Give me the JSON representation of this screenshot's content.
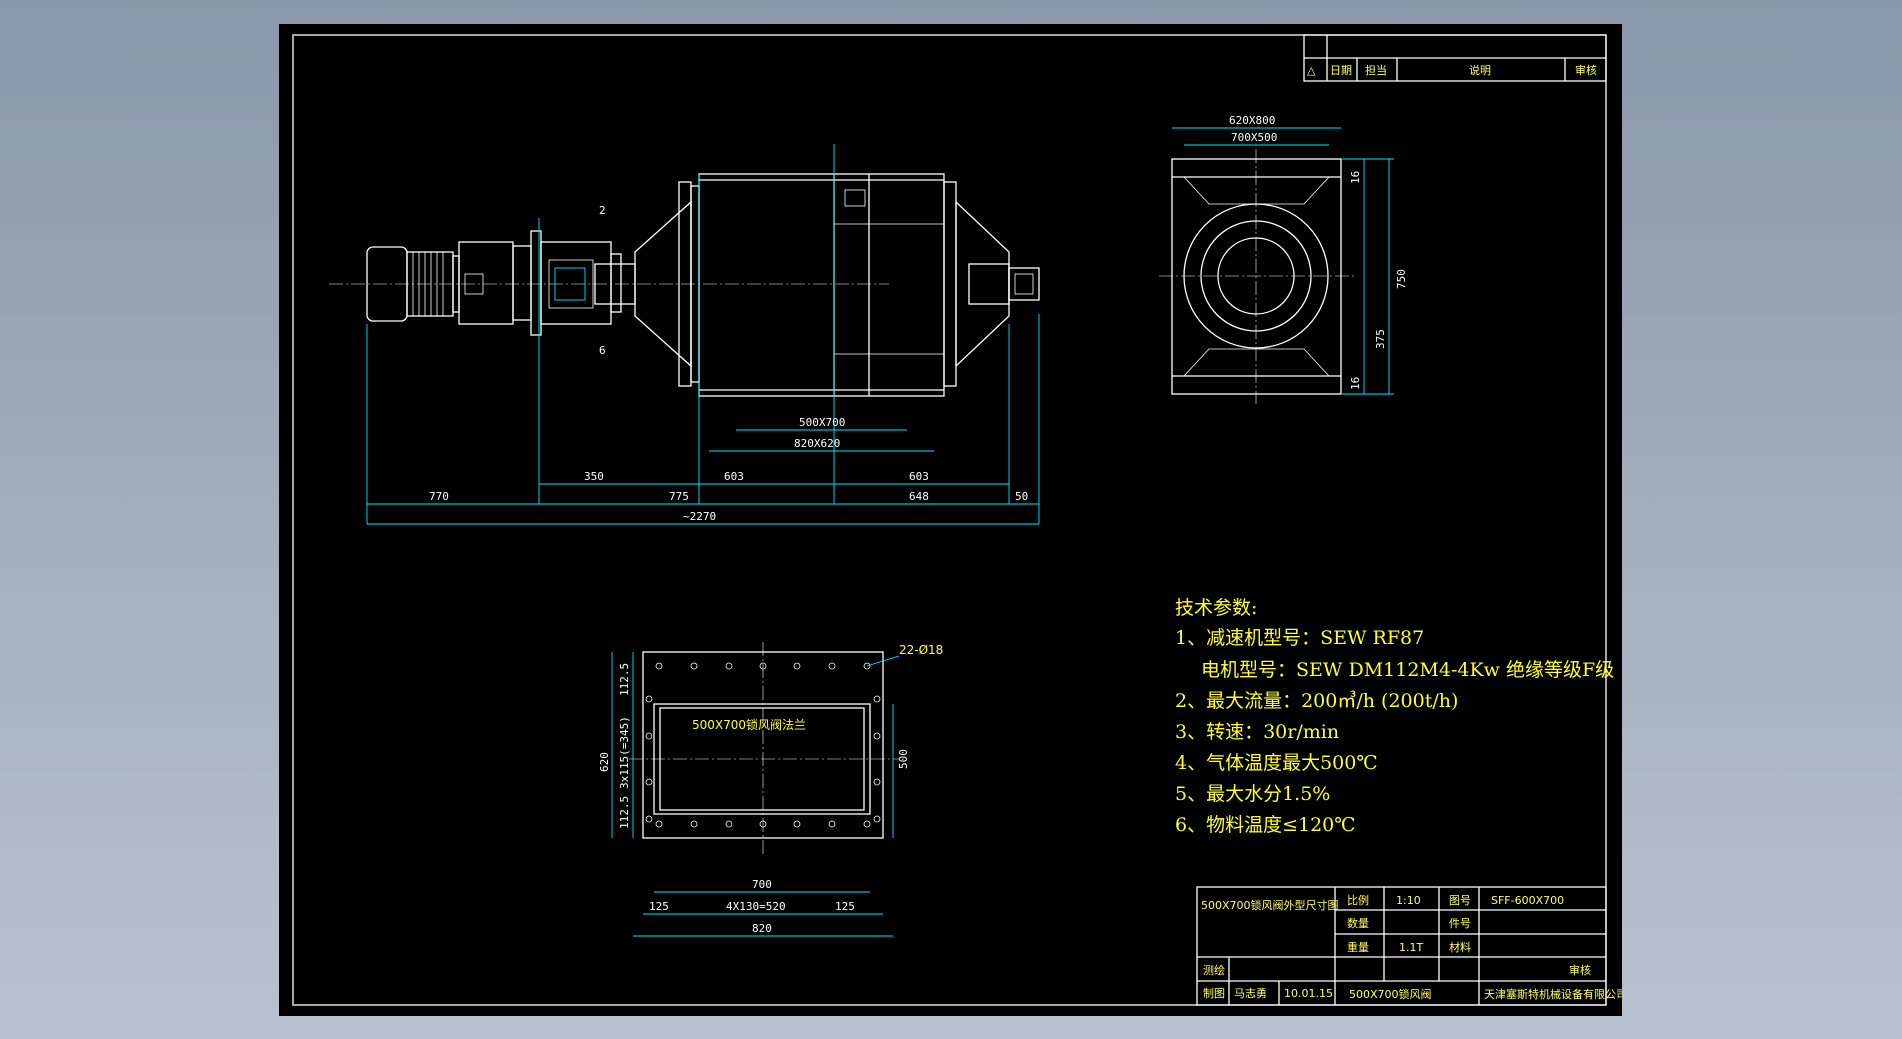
{
  "revision_table": {
    "symbol": "△",
    "date": "日期",
    "person": "担当",
    "note": "说明",
    "check": "审核"
  },
  "side_view_dims": {
    "d620x800": "620X800",
    "d700x500": "700X500",
    "d16_top": "16",
    "d750": "750",
    "d375": "375",
    "d16_bottom": "16"
  },
  "front_view_dims": {
    "d2": "2",
    "d6": "6",
    "d500x700": "500X700",
    "d820x620": "820X620",
    "d350": "350",
    "d603_left": "603",
    "d603_right": "603",
    "d770": "770",
    "d775": "775",
    "d648": "648",
    "d50": "50",
    "d2270": "~2270"
  },
  "flange_view": {
    "holes_note": "22-Ø18",
    "label": "500X700锁风阀法兰",
    "d112_5_top": "112.5",
    "d3x115": "3x115(=345)",
    "d112_5_bottom": "112.5",
    "d620": "620",
    "d500": "500",
    "d700": "700",
    "d125_left": "125",
    "d4x130": "4X130=520",
    "d125_right": "125",
    "d820": "820"
  },
  "tech_params": {
    "title": "技术参数:",
    "line1": "1、减速机型号：SEW RF87",
    "line1b": "电机型号：SEW DM112M4-4Kw  绝缘等级F级",
    "line2": "2、最大流量：200㎥/h  (200t/h)",
    "line3": "3、转速：30r/min",
    "line4": "4、气体温度最大500℃",
    "line5": "5、最大水分1.5%",
    "line6": "6、物料温度≤120℃"
  },
  "title_block": {
    "drawing_name": "500X700锁风阀外型尺寸图",
    "scale_label": "比例",
    "scale_value": "1:10",
    "drawing_no_label": "图号",
    "drawing_no_value": "SFF-600X700",
    "qty_label": "数量",
    "part_no_label": "件号",
    "designer_label": "测绘",
    "weight_label": "重量",
    "weight_value": "1.1T",
    "material_label": "材料",
    "drafter_label": "制图",
    "drafter_name": "马志勇",
    "date_value": "10.01.15",
    "product_name": "500X700锁风阀",
    "company": "天津塞斯特机械设备有限公司",
    "checker_label": "审核"
  },
  "colors": {
    "background": "#000000",
    "outline": "#ffffff",
    "dimension": "#00e6ff",
    "text": "#ffff33"
  }
}
